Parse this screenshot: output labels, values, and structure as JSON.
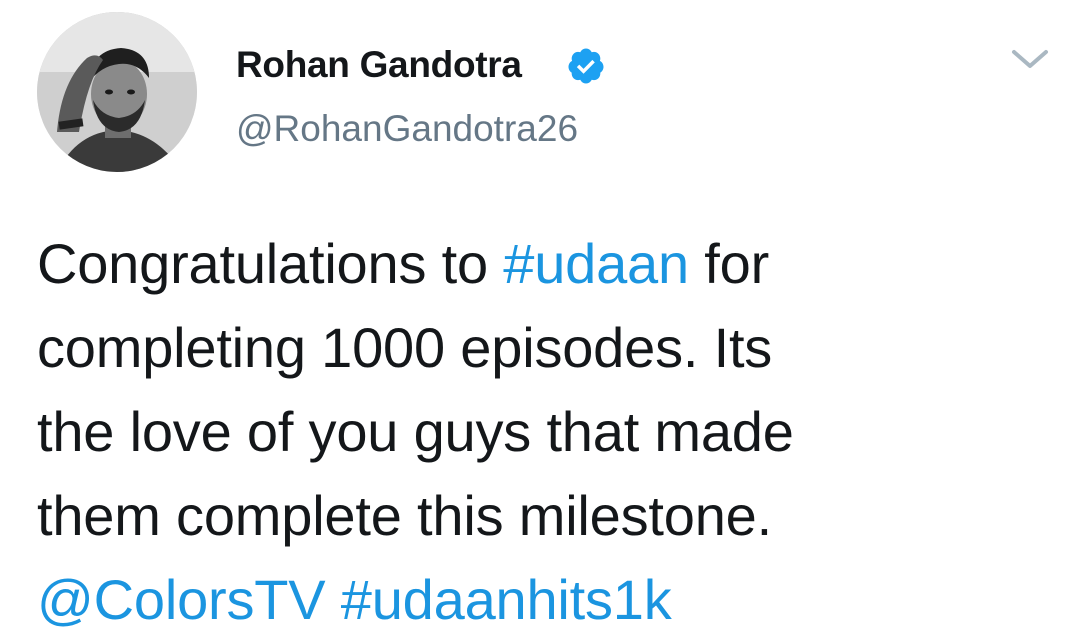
{
  "author": {
    "name": "Rohan Gandotra",
    "handle": "@RohanGandotra26",
    "verified": true,
    "verified_icon": "verified-badge-icon",
    "avatar": "profile-photo"
  },
  "menu": {
    "icon": "chevron-down-icon"
  },
  "tweet": {
    "line1": {
      "pre": "Congratulations to ",
      "hashtag": "#udaan",
      "post": " for"
    },
    "line2": "completing 1000 episodes. Its",
    "line3": "the love of you guys that made",
    "line4": "them complete this milestone.",
    "line5": {
      "mention": "@ColorsTV",
      "space": " ",
      "hashtag": "#udaanhits1k"
    }
  },
  "colors": {
    "text": "#14171a",
    "secondary": "#657786",
    "link": "#1b95e0",
    "verified": "#1da1f2",
    "chevron": "#aab8c2"
  }
}
